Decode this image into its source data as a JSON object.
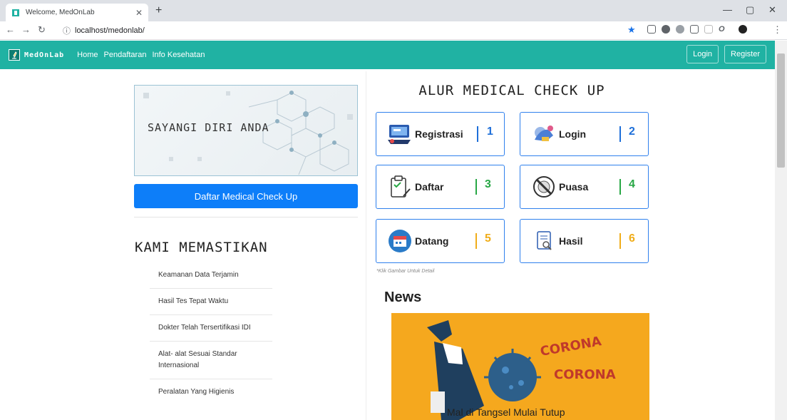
{
  "browser": {
    "tab_title": "Welcome, MedOnLab",
    "url": "localhost/medonlab/"
  },
  "navbar": {
    "brand": "MedOnLab",
    "links": [
      "Home",
      "Pendaftaran",
      "Info Kesehatan"
    ],
    "login_label": "Login",
    "register_label": "Register"
  },
  "hero": {
    "tagline": "SAYANGI DIRI ANDA",
    "cta_label": "Daftar Medical Check Up"
  },
  "assurance": {
    "heading": "KAMI MEMASTIKAN",
    "items": [
      "Keamanan Data Terjamin",
      "Hasil Tes Tepat Waktu",
      "Dokter Telah Tersertifikasi IDI",
      "Alat- alat Sesuai Standar Internasional",
      "Peralatan Yang Higienis"
    ]
  },
  "flow": {
    "heading": "ALUR MEDICAL CHECK UP",
    "steps": [
      {
        "label": "Registrasi",
        "number": "1",
        "icon": "computer-icon",
        "color": "#1e6fd9"
      },
      {
        "label": "Login",
        "number": "2",
        "icon": "login-icon",
        "color": "#1e6fd9"
      },
      {
        "label": "Daftar",
        "number": "3",
        "icon": "clipboard-icon",
        "color": "#28a745"
      },
      {
        "label": "Puasa",
        "number": "4",
        "icon": "no-food-icon",
        "color": "#28a745"
      },
      {
        "label": "Datang",
        "number": "5",
        "icon": "calendar-icon",
        "color": "#f0ad1a"
      },
      {
        "label": "Hasil",
        "number": "6",
        "icon": "report-icon",
        "color": "#f0ad1a"
      }
    ],
    "hint": "*Klik Gambar Untuk Detail"
  },
  "news": {
    "heading": "News",
    "headline": "Mal di Tangsel Mulai Tutup",
    "image_text_1": "CORONA",
    "image_text_2": "CORONA"
  }
}
